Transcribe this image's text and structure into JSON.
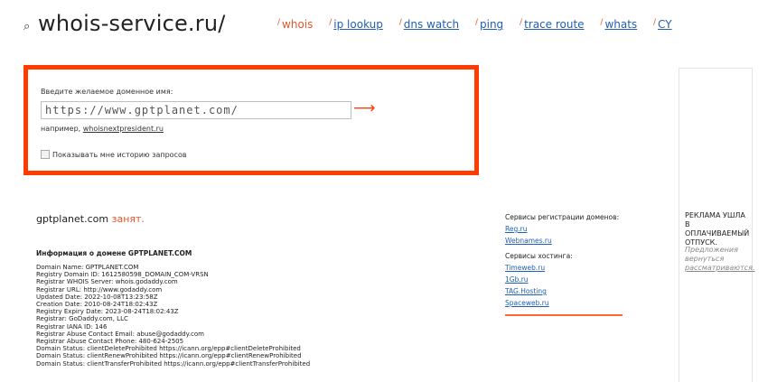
{
  "header": {
    "logo_mark": "⌕",
    "logo": "whois-service.ru/",
    "nav": [
      {
        "label": "whois",
        "active": true
      },
      {
        "label": "ip lookup"
      },
      {
        "label": "dns watch"
      },
      {
        "label": "ping"
      },
      {
        "label": "trace route"
      },
      {
        "label": "whats"
      },
      {
        "label": "CY"
      }
    ]
  },
  "search": {
    "label": "Введите желаемое доменное имя:",
    "value": "https://www.gptplanet.com/",
    "go_arrow": "⟶",
    "example_prefix": "например,",
    "example_link": "whoisnextpresident.ru",
    "history_label": "Показывать мне историю запросов"
  },
  "result": {
    "domain": "gptplanet.com",
    "status": "занят.",
    "info_title": "Информация о домене GPTPLANET.COM",
    "whois_lines": [
      "Domain Name: GPTPLANET.COM",
      "Registry Domain ID: 1612580598_DOMAIN_COM-VRSN",
      "Registrar WHOIS Server: whois.godaddy.com",
      "Registrar URL: http://www.godaddy.com",
      "Updated Date: 2022-10-08T13:23:58Z",
      "Creation Date: 2010-08-24T18:02:43Z",
      "Registry Expiry Date: 2023-08-24T18:02:43Z",
      "Registrar: GoDaddy.com, LLC",
      "Registrar IANA ID: 146",
      "Registrar Abuse Contact Email: abuse@godaddy.com",
      "Registrar Abuse Contact Phone: 480-624-2505",
      "Domain Status: clientDeleteProhibited https://icann.org/epp#clientDeleteProhibited",
      "Domain Status: clientRenewProhibited https://icann.org/epp#clientRenewProhibited",
      "Domain Status: clientTransferProhibited https://icann.org/epp#clientTransferProhibited"
    ]
  },
  "services": {
    "reg_title": "Сервисы регистрации доменов:",
    "reg_links": [
      "Reg.ru",
      "Webnames.ru"
    ],
    "host_title": "Сервисы хостинга:",
    "host_links": [
      "Timeweb.ru",
      "1Gb.ru",
      "TAG.Hosting",
      "Spaceweb.ru"
    ]
  },
  "ad": {
    "title": "РЕКЛАМА УШЛА В ОПЛАЧИВАЕМЫЙ ОТПУСК.",
    "sub_prefix": "Предложения вернуться",
    "sub_link": "рассматриваются."
  }
}
